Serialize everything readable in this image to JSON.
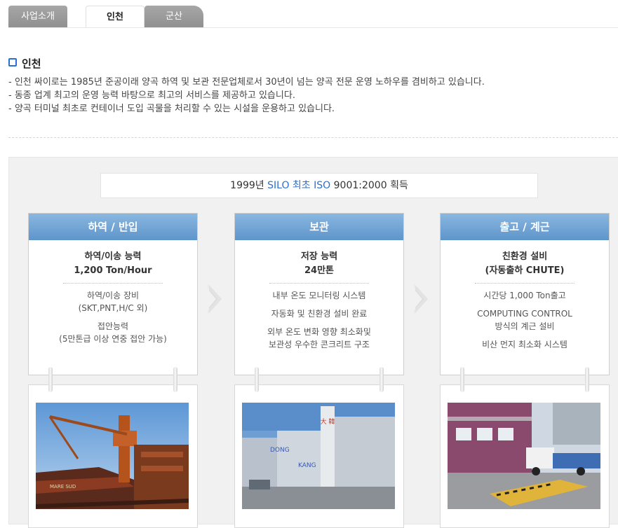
{
  "tabs": [
    {
      "label": "사업소개",
      "active": false
    },
    {
      "label": "인천",
      "active": true
    },
    {
      "label": "군산",
      "active": false
    }
  ],
  "heading": "인천",
  "description": [
    "- 인천 싸이로는 1985년 준공이래 양곡 하역 및 보관 전문업체로서 30년이 넘는 양곡 전문 운영 노하우를 겸비하고 있습니다.",
    "- 동종 업계 최고의 운영 능력 바탕으로 최고의 서비스를 제공하고 있습니다.",
    "- 양곡 터미널 최초로 컨테이너 도입 곡물을 처리할 수 있는 시설을 운용하고 있습니다."
  ],
  "banner": {
    "pre": "1999년 ",
    "highlight": "SILO 최초 ISO",
    "post": " 9001:2000 획득"
  },
  "cards": [
    {
      "header": "하역 / 반입",
      "title1": "하역/이송 능력",
      "title2": "1,200 Ton/Hour",
      "items": [
        "하역/이송 장비",
        "(SKT,PNT,H/C 외)",
        "접안능력",
        "(5만톤급 이상 연중 접안 가능)"
      ]
    },
    {
      "header": "보관",
      "title1": "저장 능력",
      "title2": "24만톤",
      "items": [
        "내부 온도 모니터링 시스템",
        "자동화 및 친환경 설비 완료",
        "외부 온도 변화 영향 최소화및",
        "보관성 우수한 콘크리트 구조"
      ]
    },
    {
      "header": "출고 / 계근",
      "title1": "친환경 설비",
      "title2": "(자동출하 CHUTE)",
      "items": [
        "시간당 1,000 Ton출고",
        "COMPUTING CONTROL",
        "방식의 계근 설비",
        "비산 먼지 최소화 시스템"
      ]
    }
  ],
  "photos": {
    "silo_sign": "大 韓",
    "silo_text1": "DONG",
    "silo_text2": "KANG",
    "ship_text": "MARE SUD"
  },
  "colors": {
    "accent": "#2a6fd1",
    "card_header": "#6d9fd3"
  }
}
